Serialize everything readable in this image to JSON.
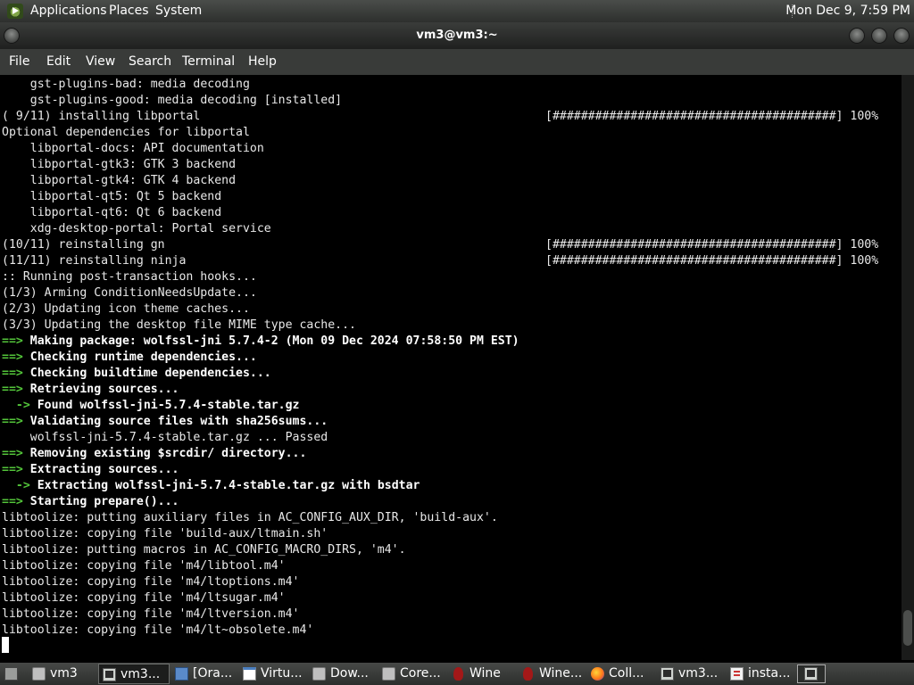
{
  "top_panel": {
    "menus": [
      "Applications",
      "Places",
      "System"
    ],
    "clock": "Mon Dec 9,  7:59 PM"
  },
  "window": {
    "title": "vm3@vm3:~"
  },
  "menu_bar": [
    "File",
    "Edit",
    "View",
    "Search",
    "Terminal",
    "Help"
  ],
  "terminal": {
    "lines": [
      {
        "pre": "    ",
        "text": "gst-plugins-bad: media decoding"
      },
      {
        "pre": "    ",
        "text": "gst-plugins-good: media decoding [installed]"
      },
      {
        "pre": "",
        "text": "( 9/11) installing libportal",
        "bar": "[########################################] 100%"
      },
      {
        "pre": "",
        "text": "Optional dependencies for libportal"
      },
      {
        "pre": "    ",
        "text": "libportal-docs: API documentation"
      },
      {
        "pre": "    ",
        "text": "libportal-gtk3: GTK 3 backend"
      },
      {
        "pre": "    ",
        "text": "libportal-gtk4: GTK 4 backend"
      },
      {
        "pre": "    ",
        "text": "libportal-qt5: Qt 5 backend"
      },
      {
        "pre": "    ",
        "text": "libportal-qt6: Qt 6 backend"
      },
      {
        "pre": "    ",
        "text": "xdg-desktop-portal: Portal service"
      },
      {
        "pre": "",
        "text": "(10/11) reinstalling gn",
        "bar": "[########################################] 100%"
      },
      {
        "pre": "",
        "text": "(11/11) reinstalling ninja",
        "bar": "[########################################] 100%"
      },
      {
        "pre": "",
        "text": ":: Running post-transaction hooks..."
      },
      {
        "pre": "",
        "text": "(1/3) Arming ConditionNeedsUpdate..."
      },
      {
        "pre": "",
        "text": "(2/3) Updating icon theme caches..."
      },
      {
        "pre": "",
        "text": "(3/3) Updating the desktop file MIME type cache..."
      },
      {
        "pre": "",
        "arrow": "==>",
        "bold": " Making package: wolfssl-jni 5.7.4-2 (Mon 09 Dec 2024 07:58:50 PM EST)"
      },
      {
        "pre": "",
        "arrow": "==>",
        "bold": " Checking runtime dependencies..."
      },
      {
        "pre": "",
        "arrow": "==>",
        "bold": " Checking buildtime dependencies..."
      },
      {
        "pre": "",
        "arrow": "==>",
        "bold": " Retrieving sources..."
      },
      {
        "pre": "  ",
        "arrow": "->",
        "bold": " Found wolfssl-jni-5.7.4-stable.tar.gz"
      },
      {
        "pre": "",
        "arrow": "==>",
        "bold": " Validating source files with sha256sums..."
      },
      {
        "pre": "    ",
        "text": "wolfssl-jni-5.7.4-stable.tar.gz ... Passed"
      },
      {
        "pre": "",
        "arrow": "==>",
        "bold": " Removing existing $srcdir/ directory..."
      },
      {
        "pre": "",
        "arrow": "==>",
        "bold": " Extracting sources..."
      },
      {
        "pre": "  ",
        "arrow": "->",
        "bold": " Extracting wolfssl-jni-5.7.4-stable.tar.gz with bsdtar"
      },
      {
        "pre": "",
        "arrow": "==>",
        "bold": " Starting prepare()..."
      },
      {
        "pre": "",
        "text": "libtoolize: putting auxiliary files in AC_CONFIG_AUX_DIR, 'build-aux'."
      },
      {
        "pre": "",
        "text": "libtoolize: copying file 'build-aux/ltmain.sh'"
      },
      {
        "pre": "",
        "text": "libtoolize: putting macros in AC_CONFIG_MACRO_DIRS, 'm4'."
      },
      {
        "pre": "",
        "text": "libtoolize: copying file 'm4/libtool.m4'"
      },
      {
        "pre": "",
        "text": "libtoolize: copying file 'm4/ltoptions.m4'"
      },
      {
        "pre": "",
        "text": "libtoolize: copying file 'm4/ltsugar.m4'"
      },
      {
        "pre": "",
        "text": "libtoolize: copying file 'm4/ltversion.m4'"
      },
      {
        "pre": "",
        "text": "libtoolize: copying file 'm4/lt~obsolete.m4'"
      }
    ]
  },
  "taskbar": {
    "tasks": [
      {
        "label": "vm3",
        "icon": "folder-icon"
      },
      {
        "label": "vm3...",
        "icon": "terminal-icon",
        "active": true
      },
      {
        "label": "[Ora...",
        "icon": "virtualbox-icon"
      },
      {
        "label": "Virtu...",
        "icon": "window-icon"
      },
      {
        "label": "Dow...",
        "icon": "folder-icon"
      },
      {
        "label": "Core...",
        "icon": "folder-icon"
      },
      {
        "label": "Wine",
        "icon": "wine-icon"
      },
      {
        "label": "Wine...",
        "icon": "wine-icon"
      },
      {
        "label": "Coll...",
        "icon": "firefox-icon"
      },
      {
        "label": "vm3...",
        "icon": "terminal-icon"
      },
      {
        "label": "insta...",
        "icon": "document-icon"
      }
    ]
  }
}
